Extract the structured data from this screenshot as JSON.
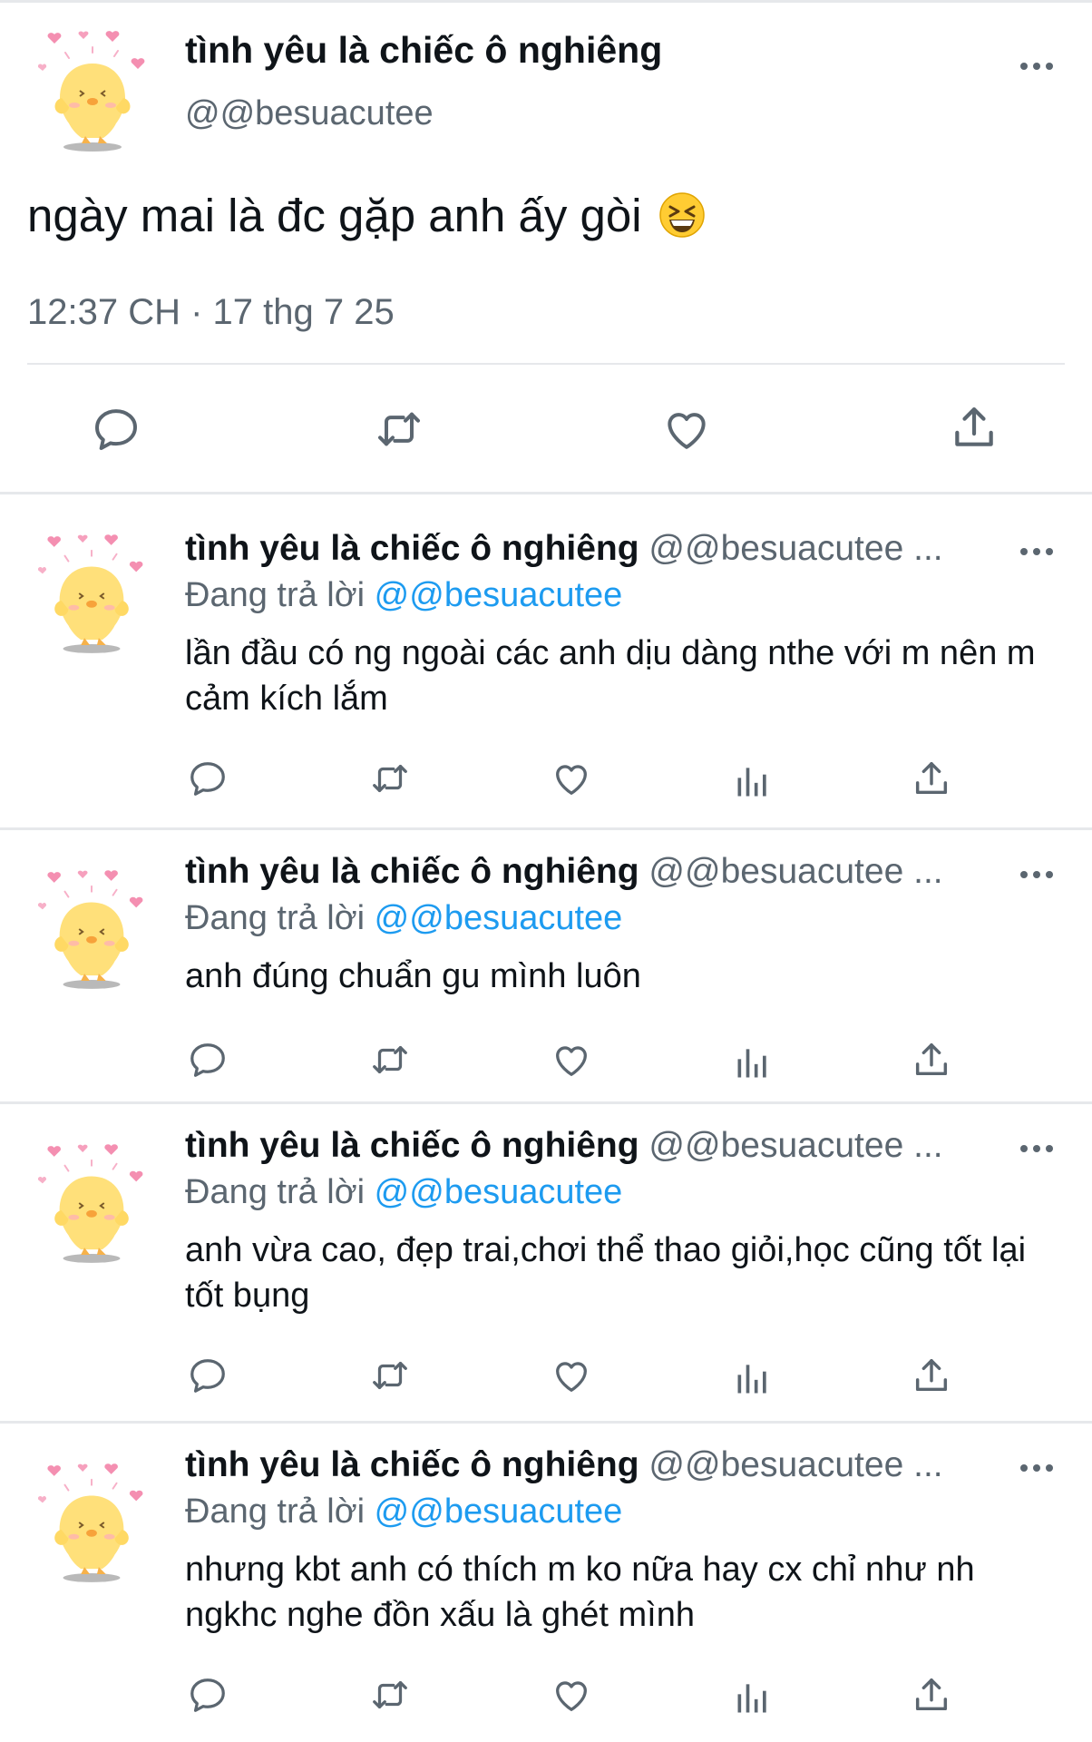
{
  "main_tweet": {
    "display_name": "tình yêu là chiếc ô nghiêng",
    "handle": "@@besuacutee",
    "text": "ngày mai là đc gặp anh ấy gòi",
    "emoji": "grinning-squinting-face",
    "timestamp": "12:37 CH · 17 thg 7 25",
    "actions": [
      "reply-icon",
      "retweet-icon",
      "like-icon",
      "share-icon"
    ]
  },
  "replies": [
    {
      "display_name": "tình yêu là chiếc ô nghiêng",
      "handle": "@@besuacutee ...",
      "replying_label": "Đang trả lời",
      "replying_to": "@@besuacutee",
      "text": "lần đầu có ng ngoài các anh dịu dàng nthe với m nên m cảm kích lắm"
    },
    {
      "display_name": "tình yêu là chiếc ô nghiêng",
      "handle": "@@besuacutee ...",
      "replying_label": "Đang trả lời",
      "replying_to": "@@besuacutee",
      "text": "anh đúng chuẩn gu mình luôn"
    },
    {
      "display_name": "tình yêu là chiếc ô nghiêng",
      "handle": "@@besuacutee ...",
      "replying_label": "Đang trả lời",
      "replying_to": "@@besuacutee",
      "text": "anh vừa cao, đẹp trai,chơi thể thao giỏi,học cũng tốt lại tốt bụng"
    },
    {
      "display_name": "tình yêu là chiếc ô nghiêng",
      "handle": "@@besuacutee ...",
      "replying_label": "Đang trả lời",
      "replying_to": "@@besuacutee",
      "text": "nhưng kbt anh có thích m ko nữa hay cx chỉ như nh ngkhc nghe đồn xấu là ghét mình"
    }
  ],
  "reply_actions": [
    "reply-icon",
    "retweet-icon",
    "like-icon",
    "views-icon",
    "share-icon"
  ],
  "colors": {
    "text": "#0f1419",
    "secondary": "#5b6670",
    "mention": "#1d9bf0",
    "divider": "#e6e8eb",
    "avatar_chick": "#ffe07a",
    "avatar_hearts": "#f48fb1"
  }
}
